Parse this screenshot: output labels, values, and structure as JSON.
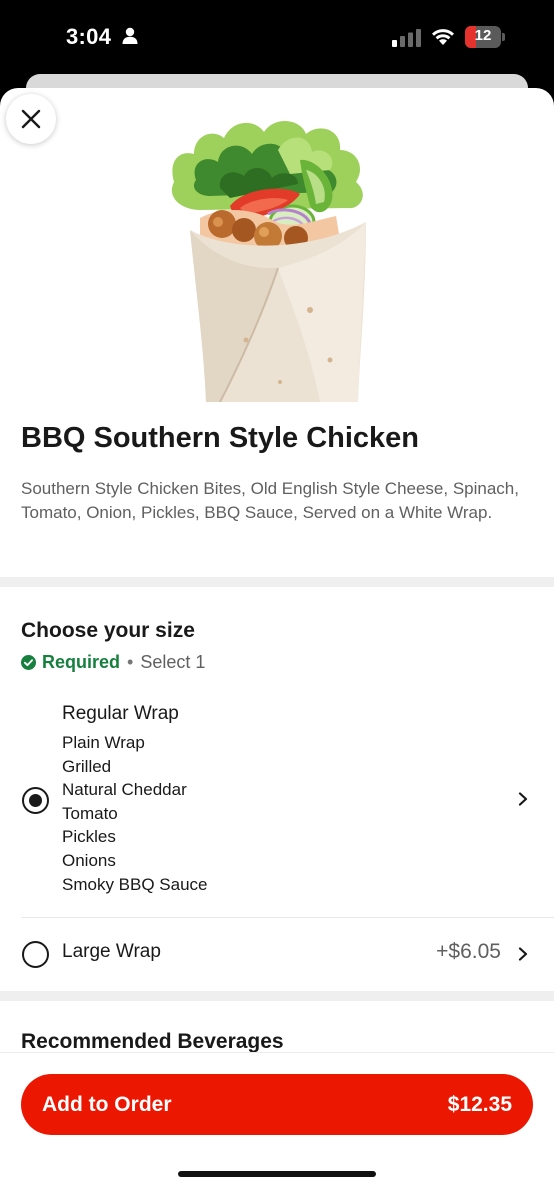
{
  "status_bar": {
    "time": "3:04",
    "battery_level": "12",
    "icons": [
      "person-icon",
      "cellular-signal-icon",
      "wifi-icon",
      "battery-icon"
    ]
  },
  "item": {
    "title": "BBQ Southern Style Chicken",
    "description": "Southern Style Chicken Bites, Old English Style Cheese, Spinach, Tomato, Onion, Pickles, BBQ Sauce, Served on a White Wrap.",
    "image": "chicken-wrap-photo"
  },
  "size_section": {
    "title": "Choose your size",
    "required_label": "Required",
    "separator": "•",
    "select_hint": "Select 1",
    "options": [
      {
        "name": "Regular Wrap",
        "selected": true,
        "details": [
          "Plain Wrap",
          "Grilled",
          "Natural Cheddar",
          "Tomato",
          "Pickles",
          "Onions",
          "Smoky BBQ Sauce"
        ]
      },
      {
        "name": "Large Wrap",
        "selected": false,
        "price": "+$6.05"
      }
    ]
  },
  "next_section": {
    "title_partial": "Recommended Beverages"
  },
  "footer": {
    "add_label": "Add to Order",
    "total": "$12.35"
  },
  "colors": {
    "brand_red": "#eb1700",
    "required_green": "#17803f",
    "text_primary": "#191919",
    "text_secondary": "#606060",
    "battery_low": "#e5322d"
  }
}
